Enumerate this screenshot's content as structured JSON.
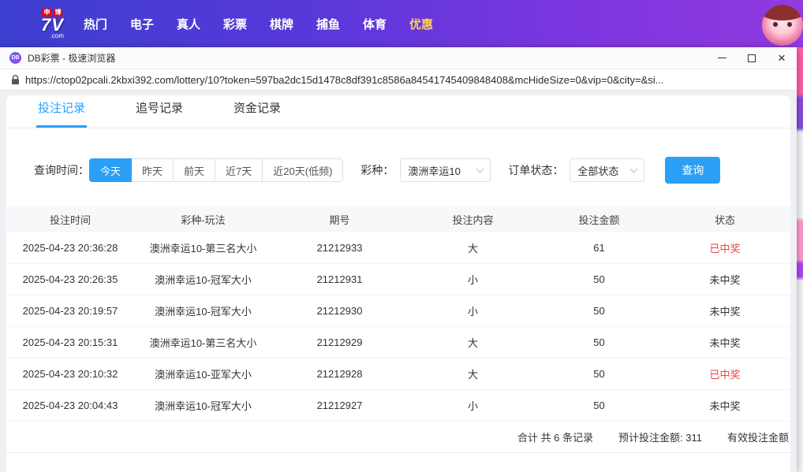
{
  "site_nav": {
    "logo_top_1": "申",
    "logo_top_2": "博",
    "logo_main": "7V",
    "logo_suffix": ".com",
    "items": [
      "热门",
      "电子",
      "真人",
      "彩票",
      "棋牌",
      "捕鱼",
      "体育",
      "优惠"
    ]
  },
  "browser": {
    "title": "DB彩票 - 极速浏览器",
    "favicon_text": "DB",
    "url": "https://ctop02pcali.2kbxi392.com/lottery/10?token=597ba2dc15d1478c8df391c8586a84541745409848408&mcHideSize=0&vip=0&city=&si...",
    "close_glyph": "×"
  },
  "tabs": [
    {
      "label": "投注记录",
      "active": true
    },
    {
      "label": "追号记录",
      "active": false
    },
    {
      "label": "资金记录",
      "active": false
    }
  ],
  "filters": {
    "time_label": "查询时间：",
    "time_options": [
      "今天",
      "昨天",
      "前天",
      "近7天",
      "近20天(低频)"
    ],
    "active_time": "今天",
    "lottery_label": "彩种：",
    "lottery_value": "澳洲幸运10",
    "status_label": "订单状态：",
    "status_value": "全部状态",
    "search_button": "查询"
  },
  "table": {
    "columns": [
      "投注时间",
      "彩种-玩法",
      "期号",
      "投注内容",
      "投注金额",
      "状态"
    ],
    "rows": [
      [
        "2025-04-23 20:36:28",
        "澳洲幸运10-第三名大小",
        "21212933",
        "大",
        "61",
        "已中奖"
      ],
      [
        "2025-04-23 20:26:35",
        "澳洲幸运10-冠军大小",
        "21212931",
        "小",
        "50",
        "未中奖"
      ],
      [
        "2025-04-23 20:19:57",
        "澳洲幸运10-冠军大小",
        "21212930",
        "小",
        "50",
        "未中奖"
      ],
      [
        "2025-04-23 20:15:31",
        "澳洲幸运10-第三名大小",
        "21212929",
        "大",
        "50",
        "未中奖"
      ],
      [
        "2025-04-23 20:10:32",
        "澳洲幸运10-亚军大小",
        "21212928",
        "大",
        "50",
        "已中奖"
      ],
      [
        "2025-04-23 20:04:43",
        "澳洲幸运10-冠军大小",
        "21212927",
        "小",
        "50",
        "未中奖"
      ]
    ]
  },
  "summary": {
    "total": "合计 共 6 条记录",
    "expected": "预计投注金额: 311",
    "valid": "有效投注金额"
  },
  "colors": {
    "accent": "#2b9ff6",
    "win_status": "#e54545",
    "nav_gradient_start": "#3c3fd0",
    "nav_gradient_end": "#913adf",
    "nav_highlight": "#ffd24d"
  }
}
